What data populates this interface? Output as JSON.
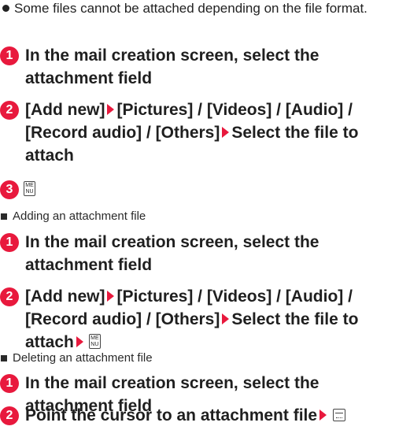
{
  "note": "Some files cannot be attached depending on the file format.",
  "section1": {
    "step1": {
      "num": "1",
      "text": "In the mail creation screen, select the attachment field"
    },
    "step2": {
      "num": "2",
      "text_a": "[Add new]",
      "text_b": "[Pictures] / [Videos] / [Audio] / [Record audio] / [Others]",
      "text_c": "Select the file to attach"
    },
    "step3": {
      "num": "3",
      "key_top": "ME",
      "key_bottom": "NU"
    }
  },
  "section2": {
    "heading": "Adding an attachment file",
    "step1": {
      "num": "1",
      "text": "In the mail creation screen, select the attachment field"
    },
    "step2": {
      "num": "2",
      "text_a": "[Add new]",
      "text_b": "[Pictures] / [Videos] / [Audio] / [Record audio] / [Others]",
      "text_c": "Select the file to attach",
      "key_top": "ME",
      "key_bottom": "NU"
    }
  },
  "section3": {
    "heading": "Deleting an attachment file",
    "step1": {
      "num": "1",
      "text": "In the mail creation screen, select the attachment field"
    },
    "step2": {
      "num": "2",
      "text": "Point the cursor to an attachment file"
    }
  },
  "colors": {
    "accent": "#e8193d",
    "text": "#1f1f1f"
  },
  "icons": {
    "menu_key": "menu-key-icon",
    "clear_key": "clear-key-icon",
    "arrow": "arrow-right-icon"
  }
}
